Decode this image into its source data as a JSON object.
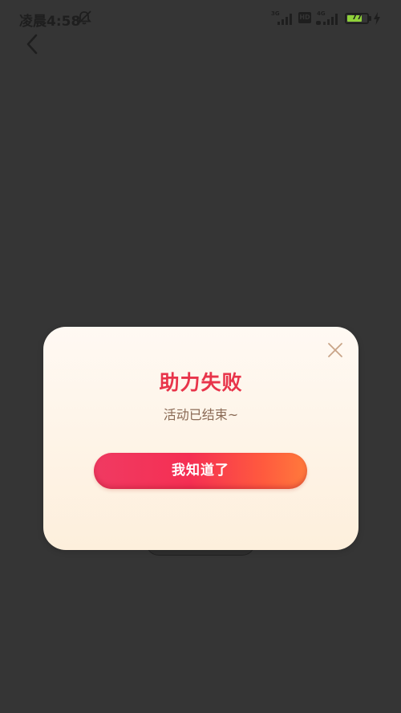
{
  "status_bar": {
    "time": "凌晨4:58",
    "network_1": "3G",
    "hd": "HD",
    "network_2": "4G",
    "battery": 77
  },
  "dialog": {
    "title": "助力失败",
    "message": "活动已结束~",
    "confirm_label": "我知道了"
  },
  "colors": {
    "backdrop": "#353535",
    "title": "#e8344a",
    "message": "#8a6a55",
    "button_start": "#f03a62",
    "button_end": "#ff7a3c"
  }
}
